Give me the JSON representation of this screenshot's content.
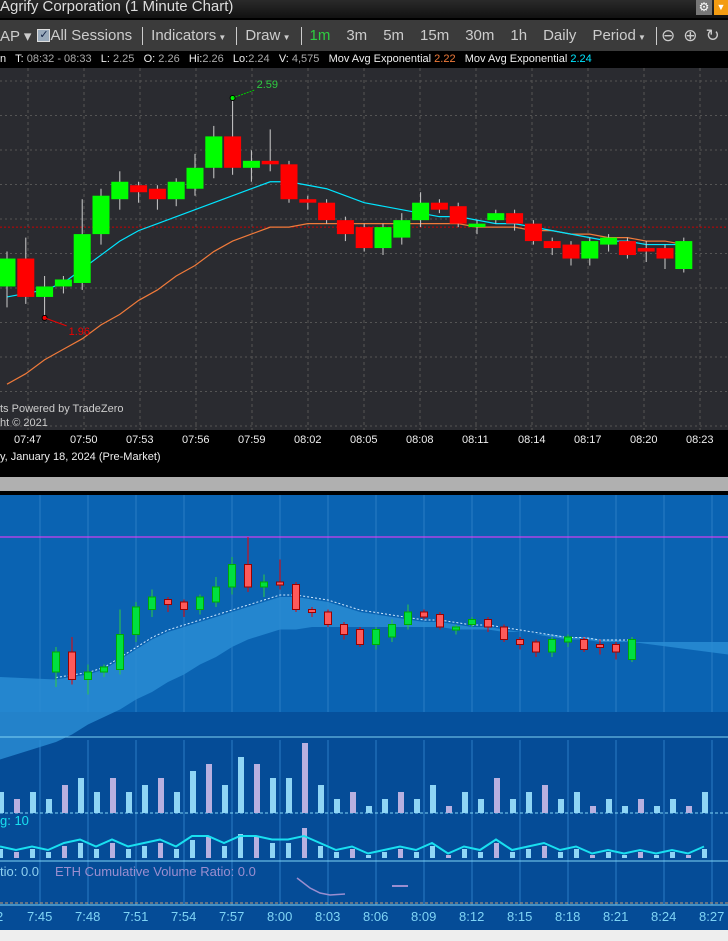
{
  "window": {
    "title": "Agrify Corporation (1 Minute Chart)",
    "gear_icon": "gear-icon",
    "menu_icon": "chevron-down-icon"
  },
  "toolbar": {
    "symbol_suffix": "AP",
    "all_sessions": "All Sessions",
    "all_sessions_checked": true,
    "indicators": "Indicators",
    "draw": "Draw",
    "periods": [
      "1m",
      "3m",
      "5m",
      "15m",
      "30m",
      "1h",
      "Daily"
    ],
    "active_period": "1m",
    "period": "Period",
    "active_color": "#2ecc40"
  },
  "info": {
    "prefix": "n",
    "t_label": "T:",
    "t": "08:32 - 08:33",
    "l_label": "L:",
    "l": "2.25",
    "o_label": "O:",
    "o": "2.26",
    "hi_label": "Hi:",
    "hi": "2.26",
    "lo_label": "Lo:",
    "lo": "2.24",
    "v_label": "V:",
    "v": "4,575",
    "ema1_label": "Mov Avg Exponential",
    "ema1": "2.22",
    "ema1_color": "#f07a3a",
    "ema2_label": "Mov Avg Exponential",
    "ema2": "2.24",
    "ema2_color": "#00e5ff"
  },
  "main": {
    "watermark1": "ts Powered by TradeZero",
    "watermark2": "ht © 2021",
    "high_label": "2.59",
    "low_label": "1.96",
    "time_ticks": [
      "07:47",
      "07:50",
      "07:53",
      "07:56",
      "07:59",
      "08:02",
      "08:05",
      "08:08",
      "08:11",
      "08:14",
      "08:17",
      "08:20",
      "08:23"
    ],
    "date": "y, January 18, 2024 (Pre-Market)"
  },
  "chart_data": {
    "type": "candlestick",
    "start": "07:46",
    "interval_min": 1,
    "open": [
      2.05,
      2.13,
      2.02,
      2.05,
      2.06,
      2.2,
      2.3,
      2.34,
      2.33,
      2.3,
      2.33,
      2.39,
      2.48,
      2.39,
      2.41,
      2.4,
      2.3,
      2.29,
      2.24,
      2.22,
      2.16,
      2.19,
      2.24,
      2.29,
      2.28,
      2.22,
      2.24,
      2.26,
      2.23,
      2.18,
      2.17,
      2.13,
      2.17,
      2.18,
      2.16,
      2.16,
      2.1
    ],
    "high": [
      2.15,
      2.19,
      2.08,
      2.08,
      2.3,
      2.33,
      2.38,
      2.35,
      2.34,
      2.36,
      2.43,
      2.51,
      2.59,
      2.44,
      2.5,
      2.41,
      2.31,
      2.3,
      2.25,
      2.23,
      2.23,
      2.26,
      2.32,
      2.3,
      2.29,
      2.24,
      2.27,
      2.27,
      2.24,
      2.19,
      2.18,
      2.19,
      2.2,
      2.19,
      2.18,
      2.17,
      2.19
    ],
    "low": [
      1.99,
      2.0,
      1.96,
      2.03,
      2.04,
      2.17,
      2.27,
      2.29,
      2.27,
      2.28,
      2.31,
      2.36,
      2.37,
      2.35,
      2.38,
      2.29,
      2.27,
      2.23,
      2.18,
      2.15,
      2.14,
      2.17,
      2.22,
      2.26,
      2.22,
      2.2,
      2.23,
      2.21,
      2.17,
      2.14,
      2.11,
      2.11,
      2.15,
      2.13,
      2.12,
      2.1,
      2.09
    ],
    "close": [
      2.13,
      2.02,
      2.05,
      2.07,
      2.2,
      2.31,
      2.35,
      2.32,
      2.3,
      2.35,
      2.39,
      2.48,
      2.39,
      2.41,
      2.4,
      2.3,
      2.29,
      2.24,
      2.2,
      2.16,
      2.22,
      2.24,
      2.29,
      2.27,
      2.23,
      2.23,
      2.26,
      2.23,
      2.18,
      2.16,
      2.13,
      2.18,
      2.19,
      2.14,
      2.15,
      2.13,
      2.18
    ],
    "ema_fast": [
      2.02,
      2.03,
      2.04,
      2.06,
      2.1,
      2.14,
      2.18,
      2.21,
      2.23,
      2.25,
      2.27,
      2.29,
      2.31,
      2.33,
      2.35,
      2.35,
      2.34,
      2.33,
      2.31,
      2.29,
      2.28,
      2.27,
      2.26,
      2.25,
      2.25,
      2.24,
      2.23,
      2.23,
      2.22,
      2.21,
      2.2,
      2.19,
      2.18,
      2.18,
      2.17,
      2.17,
      2.17
    ],
    "ema_slow": [
      1.77,
      1.8,
      1.84,
      1.87,
      1.9,
      1.94,
      1.97,
      2.01,
      2.04,
      2.08,
      2.11,
      2.15,
      2.18,
      2.2,
      2.22,
      2.22,
      2.23,
      2.23,
      2.23,
      2.23,
      2.23,
      2.23,
      2.23,
      2.23,
      2.23,
      2.22,
      2.22,
      2.22,
      2.21,
      2.21,
      2.2,
      2.2,
      2.19,
      2.19,
      2.18,
      2.18,
      2.17
    ],
    "volume": [
      3,
      2,
      3,
      2,
      4,
      5,
      3,
      5,
      3,
      4,
      5,
      3,
      6,
      7,
      4,
      8,
      7,
      5,
      5,
      10,
      4,
      2,
      3,
      1,
      2,
      3,
      2,
      4,
      1,
      3,
      2,
      5,
      2,
      3,
      4,
      2,
      3,
      1,
      2,
      1,
      2,
      1,
      2,
      1,
      3
    ],
    "high_marker": 2.59,
    "low_marker": 1.96
  },
  "lower": {
    "volume_label": "g: 10",
    "ratio_label": "tio: 0.0",
    "eth_label": "ETH Cumulative Volume Ratio: 0.0",
    "time_ticks": [
      "2",
      "7:45",
      "7:48",
      "7:51",
      "7:54",
      "7:57",
      "8:00",
      "8:03",
      "8:06",
      "8:09",
      "8:12",
      "8:15",
      "8:18",
      "8:21",
      "8:24",
      "8:27"
    ]
  }
}
